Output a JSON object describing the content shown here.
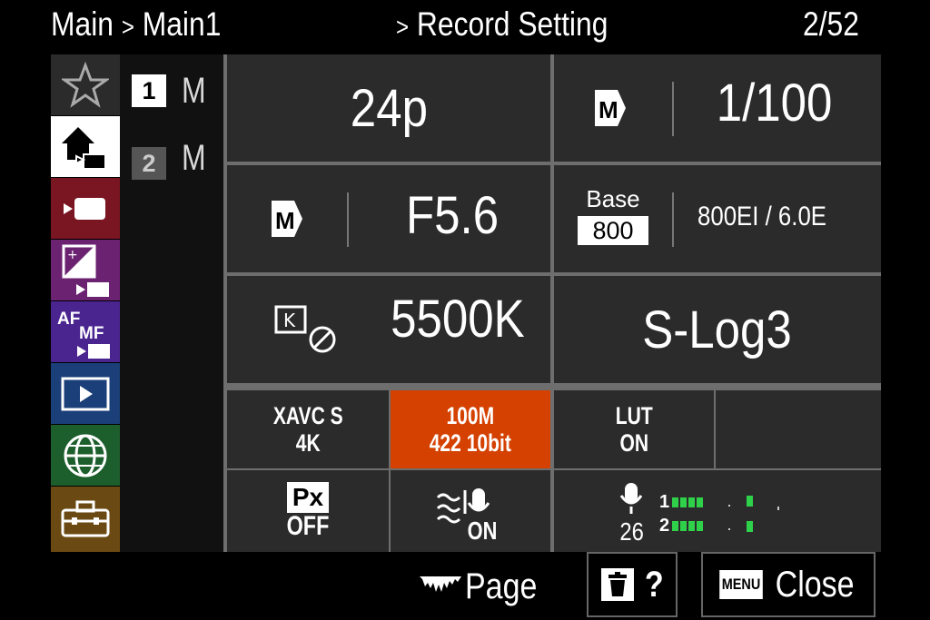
{
  "header": {
    "breadcrumb_main": "Main",
    "breadcrumb_sep1": ">",
    "breadcrumb_sub": "Main1",
    "breadcrumb_sep2": ">",
    "section": "Record Setting",
    "page_indicator": "2/52"
  },
  "sidebar": {
    "items": [
      {
        "icon": "star-icon",
        "color": "#2b2b2b"
      },
      {
        "icon": "home-camera-icon",
        "color": "#ffffff",
        "selected": true
      },
      {
        "icon": "movie-camera-icon",
        "color": "#7a1522"
      },
      {
        "icon": "exposure-icon",
        "color": "#6b2270"
      },
      {
        "icon": "af-mf-icon",
        "color": "#4a2590",
        "label_af": "AF",
        "label_mf": "MF"
      },
      {
        "icon": "playback-icon",
        "color": "#1b3f78"
      },
      {
        "icon": "network-globe-icon",
        "color": "#1d5e2d"
      },
      {
        "icon": "toolbox-icon",
        "color": "#6a4a12"
      }
    ]
  },
  "submenu": {
    "items": [
      {
        "num": "1",
        "label": "M"
      },
      {
        "num": "2",
        "label": "M"
      }
    ]
  },
  "settings": {
    "frame_rate": "24p",
    "shutter": "1/100",
    "aperture": "F5.6",
    "base_label": "Base",
    "base_iso": "800",
    "exposure_index": "800EI / 6.0E",
    "white_balance": "5500K",
    "gamma": "S-Log3",
    "wb_k_label": "K",
    "m_label": "M",
    "format_line1": "XAVC S",
    "format_line2": "4K",
    "bitrate_line1": "100M",
    "bitrate_line2": "422 10bit",
    "lut_line1": "LUT",
    "lut_line2": "ON",
    "proxy_label": "Px",
    "proxy_value": "OFF",
    "wind_value": "ON",
    "audio_level": "26",
    "audio_ch1": "1",
    "audio_ch2": "2"
  },
  "footer": {
    "page_label": "Page",
    "help_label": "?",
    "menu_label": "MENU",
    "close_label": "Close"
  },
  "colors": {
    "highlight": "#d44100",
    "meter": "#2fd14a"
  }
}
